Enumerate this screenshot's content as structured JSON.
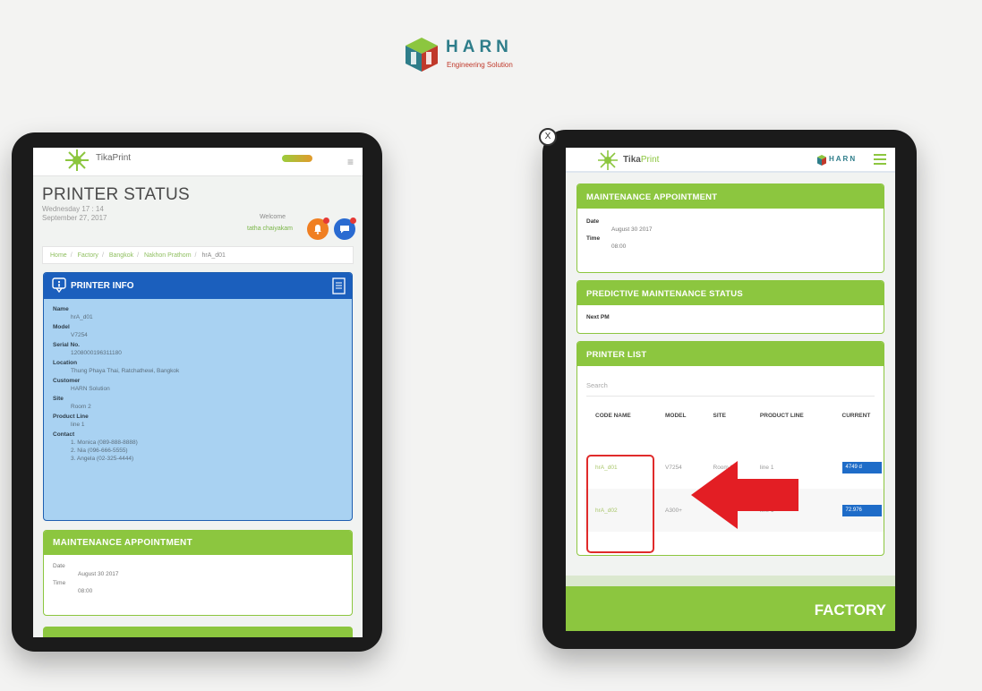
{
  "brand": {
    "name": "HARN",
    "tagline": "Engineering Solution",
    "colors": {
      "teal": "#2e7d8a",
      "green": "#8cc63f",
      "red": "#c0392b"
    }
  },
  "left_tablet": {
    "topbar": {
      "app_name": "TikaPrint",
      "menu_icon": "menu-icon"
    },
    "header": {
      "title": "PRINTER STATUS",
      "date_line1": "Wednesday 17 : 14",
      "date_line2": "September 27, 2017",
      "welcome": "Welcome",
      "user": "tatha chaiyakam",
      "notification_icon": "notification-icon",
      "chat_icon": "chat-icon"
    },
    "breadcrumb": [
      "Home",
      "Factory",
      "Bangkok",
      "Nakhon Prathom",
      "hrA_d01"
    ],
    "printer_info": {
      "title": "PRINTER INFO",
      "fields": [
        {
          "label": "Name",
          "value": "hrA_d01"
        },
        {
          "label": "Model",
          "value": "V7254"
        },
        {
          "label": "Serial No.",
          "value": "1208000196311180"
        },
        {
          "label": "Location",
          "value": "Thung Phaya Thai, Ratchathewi, Bangkok"
        },
        {
          "label": "Customer",
          "value": "HARN Solution"
        },
        {
          "label": "Site",
          "value": "Room 2"
        },
        {
          "label": "Product Line",
          "value": "line 1"
        }
      ],
      "contact_label": "Contact",
      "contacts": [
        "1. Monica (089-888-8888)",
        "2. Nia (096-666-5555)",
        "3. Angela (02-325-4444)"
      ]
    },
    "maintenance": {
      "title": "MAINTENANCE APPOINTMENT",
      "date_label": "Date",
      "date_value": "August 30 2017",
      "time_label": "Time",
      "time_value": "08:00"
    }
  },
  "right_tablet": {
    "topbar": {
      "app_name": "Tika",
      "app_name_accent": "Print",
      "brand_small": "HARN"
    },
    "close_label": "X",
    "maintenance": {
      "title": "MAINTENANCE APPOINTMENT",
      "date_label": "Date",
      "date_value": "August 30 2017",
      "time_label": "Time",
      "time_value": "08:00"
    },
    "predictive": {
      "title": "PREDICTIVE MAINTENANCE STATUS",
      "next_pm_label": "Next PM"
    },
    "printer_list": {
      "title": "PRINTER LIST",
      "search_placeholder": "Search",
      "columns": [
        "CODE NAME",
        "MODEL",
        "SITE",
        "PRODUCT LINE",
        "CURRENT"
      ],
      "rows": [
        {
          "code": "hrA_d01",
          "model": "V7254",
          "site": "Room 2",
          "line": "line 1",
          "current": "4749 d"
        },
        {
          "code": "hrA_d02",
          "model": "A300+",
          "site": "Room 2",
          "line": "line 1",
          "current": "72.976"
        }
      ]
    },
    "footer": {
      "label": "FACTORY"
    }
  }
}
